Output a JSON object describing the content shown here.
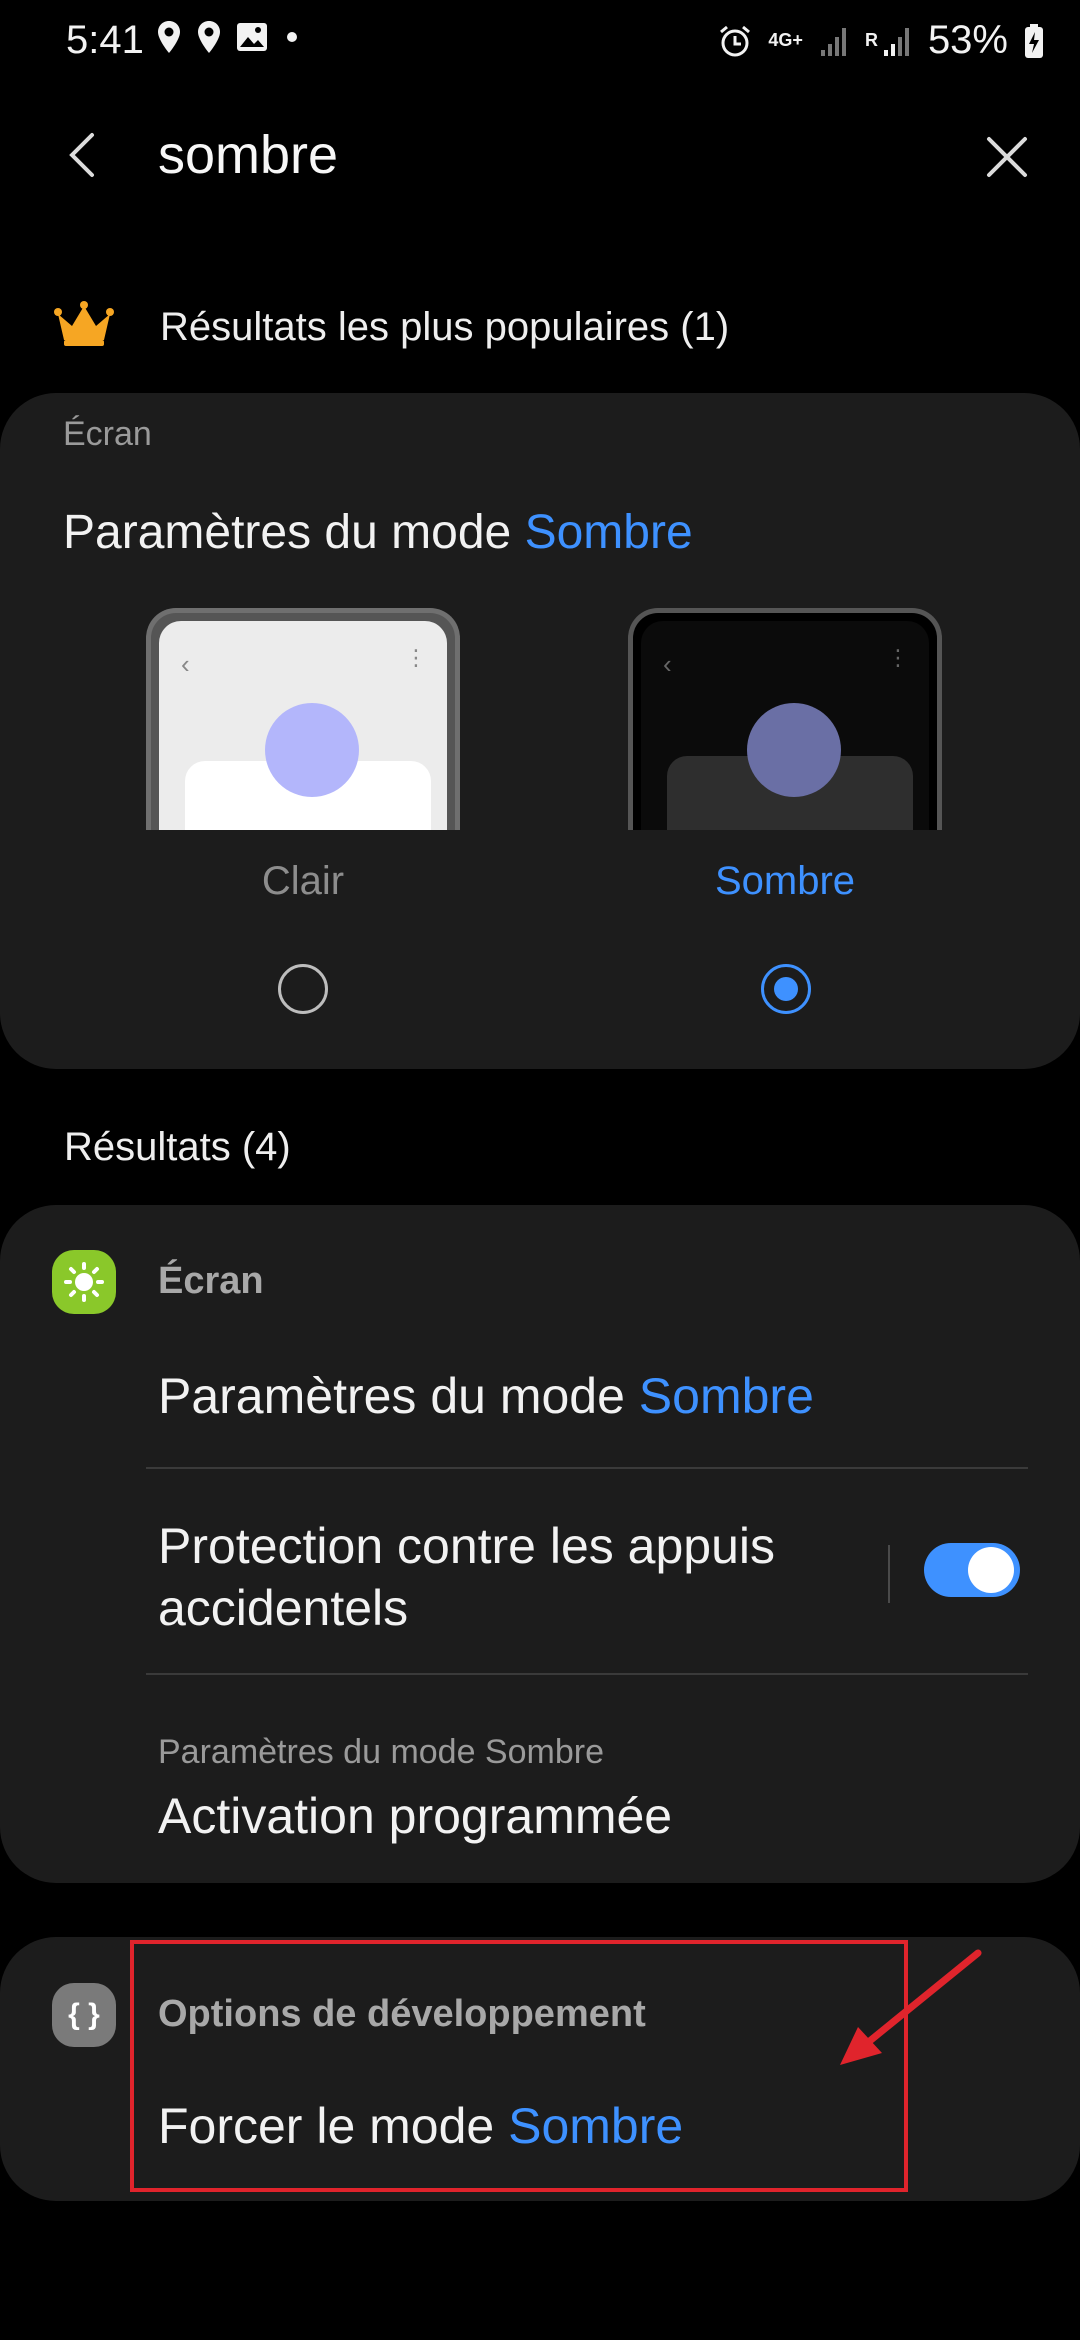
{
  "status_bar": {
    "time": "5:41",
    "network": "4G+",
    "roaming_mark": "R",
    "battery": "53%",
    "icons_left": [
      "location-icon",
      "location-icon",
      "image-icon",
      "dot-icon"
    ],
    "icons_right": [
      "alarm-icon",
      "network-icon",
      "signal-icon",
      "signal-icon",
      "battery-charging-icon"
    ]
  },
  "search": {
    "query": "sombre",
    "back_icon": "back-icon",
    "close_icon": "close-icon"
  },
  "popular": {
    "title": "Résultats les plus populaires (1)",
    "icon": "crown-icon",
    "card": {
      "category": "Écran",
      "title_prefix": "Paramètres du mode ",
      "title_highlight": "Sombre",
      "options": [
        {
          "label": "Clair",
          "selected": false
        },
        {
          "label": "Sombre",
          "selected": true
        }
      ]
    }
  },
  "results": {
    "title": "Résultats (4)",
    "groups": [
      {
        "category": "Écran",
        "icon": "brightness-icon",
        "items": [
          {
            "title_prefix": "Paramètres du mode ",
            "title_highlight": "Sombre"
          },
          {
            "title": "Protection contre les appuis accidentels",
            "toggle_on": true
          },
          {
            "subtitle": "Paramètres du mode Sombre",
            "title": "Activation programmée"
          }
        ]
      },
      {
        "category": "Options de développement",
        "icon": "developer-options-icon",
        "icon_glyph": "{ }",
        "items": [
          {
            "title_prefix": "Forcer le mode ",
            "title_highlight": "Sombre"
          }
        ]
      }
    ]
  },
  "annotation": {
    "color": "#e0242c"
  },
  "colors": {
    "accent": "#3e91ff",
    "background": "#000000",
    "card": "#1c1c1c",
    "toggle_on": "#3e91ff",
    "screen_icon": "#8ac82a"
  }
}
